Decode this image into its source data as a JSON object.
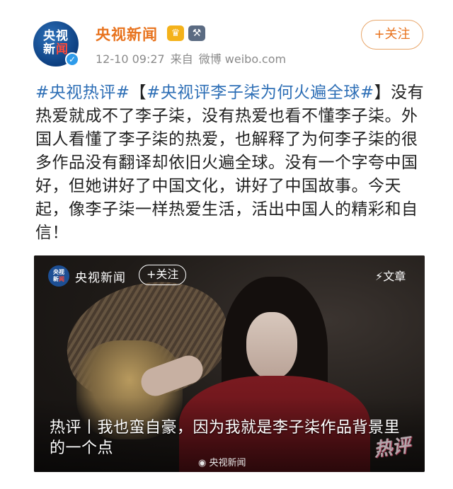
{
  "account": {
    "avatar_line1": "央视",
    "avatar_line2a": "新",
    "avatar_line2b": "闻",
    "name": "央视新闻",
    "time": "12-10 09:27",
    "source_prefix": "来自",
    "source": "微博 weibo.com",
    "follow_label": "+关注"
  },
  "post": {
    "tag1": "#央视热评#",
    "bracket_open": "【",
    "tag2": "#央视评李子柒为何火遍全球#",
    "bracket_close": "】",
    "body": "没有热爱就成不了李子柒，没有热爱也看不懂李子柒。外国人看懂了李子柒的热爱，也解释了为何李子柒的很多作品没有翻译却依旧火遍全球。没有一个字夸中国好，但她讲好了中国文化，讲好了中国故事。今天起，像李子柒一样热爱生活，活出中国人的精彩和自信！"
  },
  "video": {
    "logo_line1": "央视",
    "logo_line2a": "新",
    "logo_line2b": "闻",
    "name": "央视新闻",
    "follow_label": "+关注",
    "article_label": "⚡文章",
    "caption": "热评丨我也蛮自豪，因为我就是李子柒作品背景里的一个点",
    "watermark": "央视新闻",
    "brand_mark": "热评"
  },
  "colors": {
    "username": "#e8731e",
    "hashtag": "#2e6fb6",
    "verified": "#2e9bea"
  }
}
